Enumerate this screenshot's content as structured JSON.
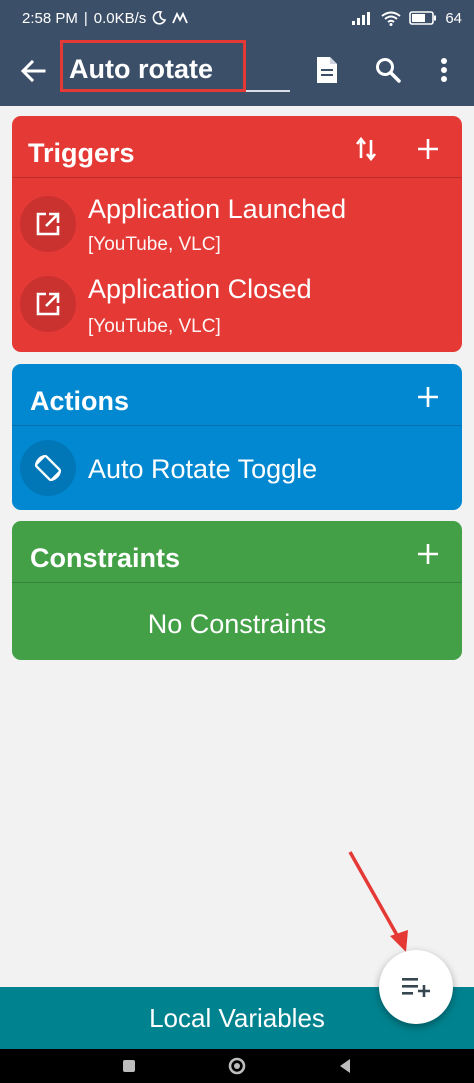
{
  "status": {
    "time": "2:58 PM",
    "separator": "|",
    "net_speed": "0.0KB/s",
    "battery": "64"
  },
  "appbar": {
    "title": "Auto rotate",
    "back_icon": "arrow-back-icon",
    "icons": [
      "document-icon",
      "search-icon",
      "more-vert-icon"
    ]
  },
  "triggers": {
    "title": "Triggers",
    "items": [
      {
        "title": "Application Launched",
        "subtitle": "[YouTube, VLC]",
        "icon": "open-in-new-icon"
      },
      {
        "title": "Application Closed",
        "subtitle": "[YouTube, VLC]",
        "icon": "open-in-new-icon"
      }
    ],
    "color": "#e53935"
  },
  "actions": {
    "title": "Actions",
    "items": [
      {
        "title": "Auto Rotate Toggle",
        "icon": "screen-rotation-icon"
      }
    ],
    "color": "#0288d1"
  },
  "constraints": {
    "title": "Constraints",
    "empty_text": "No Constraints",
    "color": "#43a047"
  },
  "bottom": {
    "local_variables_label": "Local Variables",
    "fab_icon": "playlist-add-icon"
  },
  "colors": {
    "appbar": "#3c4f69",
    "annotation": "#e53935",
    "local_variables_bar": "#00838f"
  }
}
